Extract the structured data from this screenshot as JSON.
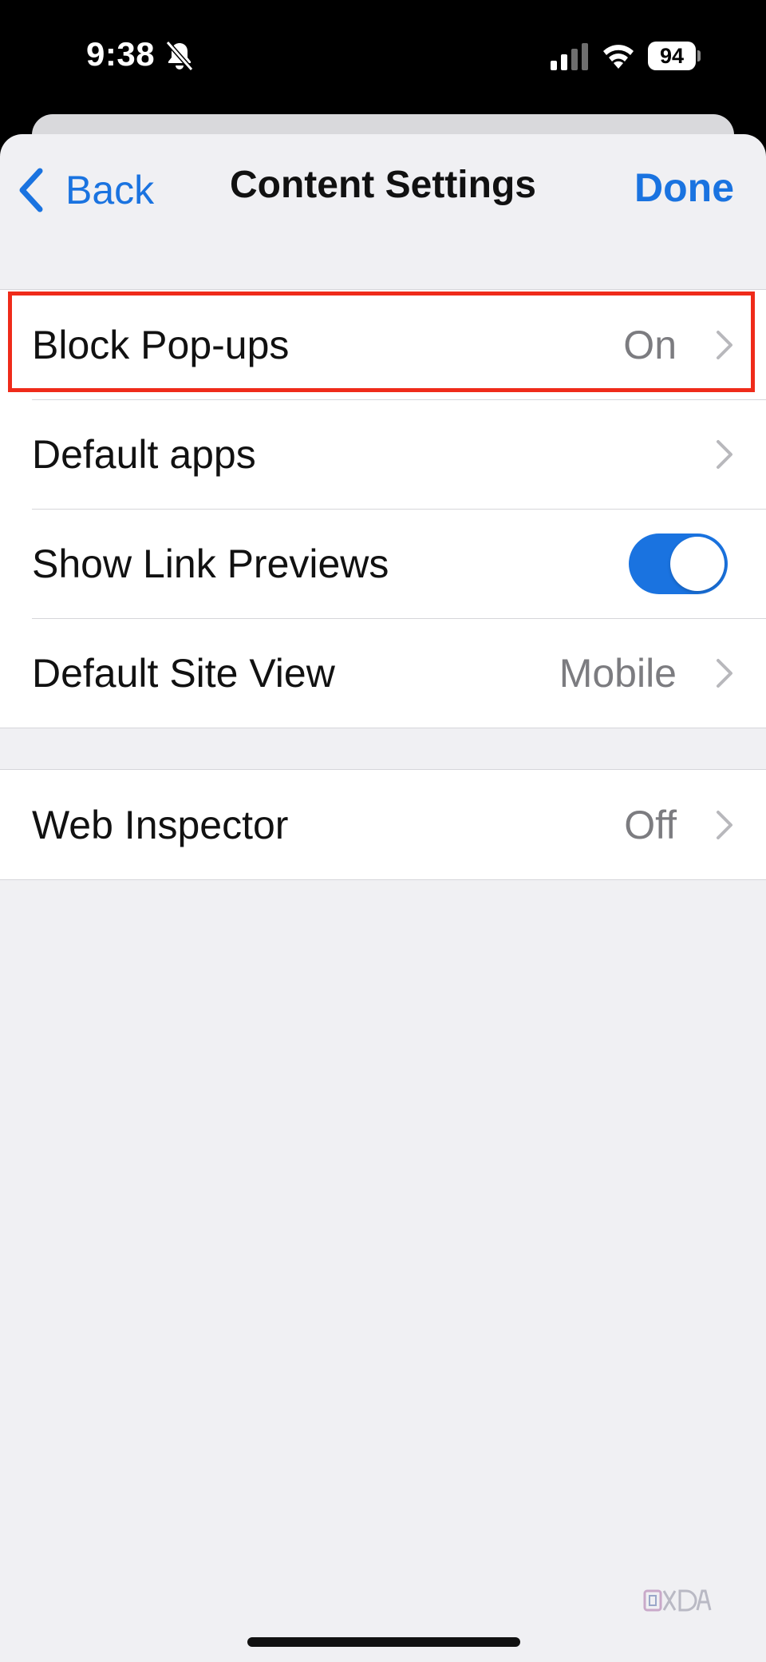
{
  "status_bar": {
    "time": "9:38",
    "battery_level": "94",
    "icons": [
      "bell-slash-icon",
      "cellular-signal-icon",
      "wifi-icon",
      "battery-icon"
    ]
  },
  "nav": {
    "back_label": "Back",
    "title": "Content Settings",
    "done_label": "Done"
  },
  "section_1": {
    "rows": [
      {
        "label": "Block Pop-ups",
        "value": "On",
        "accessory": "chevron"
      },
      {
        "label": "Default apps",
        "value": "",
        "accessory": "chevron"
      },
      {
        "label": "Show Link Previews",
        "value": "",
        "accessory": "toggle",
        "toggle_on": true
      },
      {
        "label": "Default Site View",
        "value": "Mobile",
        "accessory": "chevron"
      }
    ]
  },
  "section_2": {
    "rows": [
      {
        "label": "Web Inspector",
        "value": "Off",
        "accessory": "chevron"
      }
    ]
  },
  "highlight": {
    "target": "Block Pop-ups",
    "color": "#ef2b1a"
  },
  "colors": {
    "accent": "#1a73e0",
    "background": "#f0f0f3",
    "value_text": "#7c7c80"
  },
  "watermark_logo": "XDA"
}
